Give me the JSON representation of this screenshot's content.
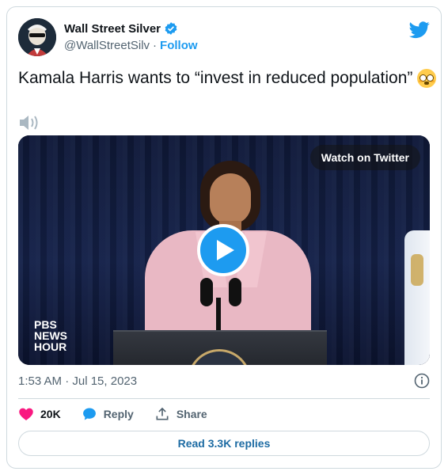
{
  "author": {
    "name": "Wall Street Silver",
    "handle": "@WallStreetSilv",
    "separator": "·",
    "follow_label": "Follow"
  },
  "tweet": {
    "text": "Kamala Harris wants to “invest in reduced population”",
    "emoji": "flushed-face-emoji",
    "timestamp": "1:53 AM · Jul 15, 2023"
  },
  "media": {
    "watch_label": "Watch on Twitter",
    "logo_lines": [
      "PBS",
      "NEWS",
      "HOUR"
    ]
  },
  "actions": {
    "likes": "20K",
    "reply_label": "Reply",
    "share_label": "Share"
  },
  "replies_button": "Read 3.3K replies",
  "colors": {
    "accent": "#1d9bf0",
    "like": "#f91880",
    "text_secondary": "#536471",
    "border": "#cfd9de"
  }
}
